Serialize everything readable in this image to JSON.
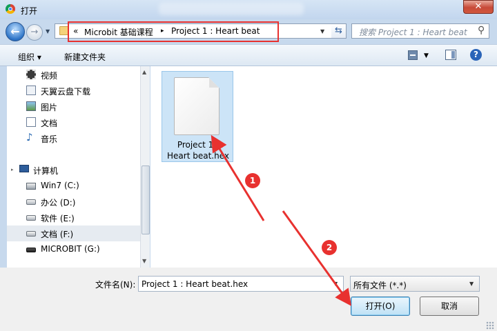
{
  "window": {
    "title": "打开",
    "close_symbol": "✕"
  },
  "address": {
    "breadcrumb_prefix": "«",
    "crumbs": [
      "Microbit 基础课程",
      "Project 1 : Heart beat"
    ],
    "separator": "▸"
  },
  "search": {
    "placeholder": "搜索 Project 1 : Heart beat"
  },
  "toolbar": {
    "organize_label": "组织 ▾",
    "new_folder_label": "新建文件夹"
  },
  "nav": {
    "favorites": [
      {
        "label": "视频",
        "icon": "video-icon"
      },
      {
        "label": "天翼云盘下载",
        "icon": "download-icon"
      },
      {
        "label": "图片",
        "icon": "pictures-icon"
      },
      {
        "label": "文档",
        "icon": "documents-icon"
      },
      {
        "label": "音乐",
        "icon": "music-icon"
      }
    ],
    "computer_label": "计算机",
    "drives": [
      {
        "label": "Win7 (C:)",
        "icon": "system-drive-icon"
      },
      {
        "label": "办公 (D:)",
        "icon": "drive-icon"
      },
      {
        "label": "软件 (E:)",
        "icon": "drive-icon"
      },
      {
        "label": "文档 (F:)",
        "icon": "drive-icon",
        "selected": true
      },
      {
        "label": "MICROBIT (G:)",
        "icon": "usb-drive-icon"
      }
    ]
  },
  "files": [
    {
      "name_line1": "Project 1 :",
      "name_line2": "Heart beat.hex",
      "icon": "document-icon",
      "selected": true
    }
  ],
  "bottom": {
    "filename_label": "文件名(N):",
    "filename_value": "Project 1 : Heart beat.hex",
    "filetype_value": "所有文件 (*.*)",
    "open_label": "打开(O)",
    "cancel_label": "取消"
  },
  "annotations": {
    "badge1": "1",
    "badge2": "2",
    "accent_color": "#e8312f"
  }
}
